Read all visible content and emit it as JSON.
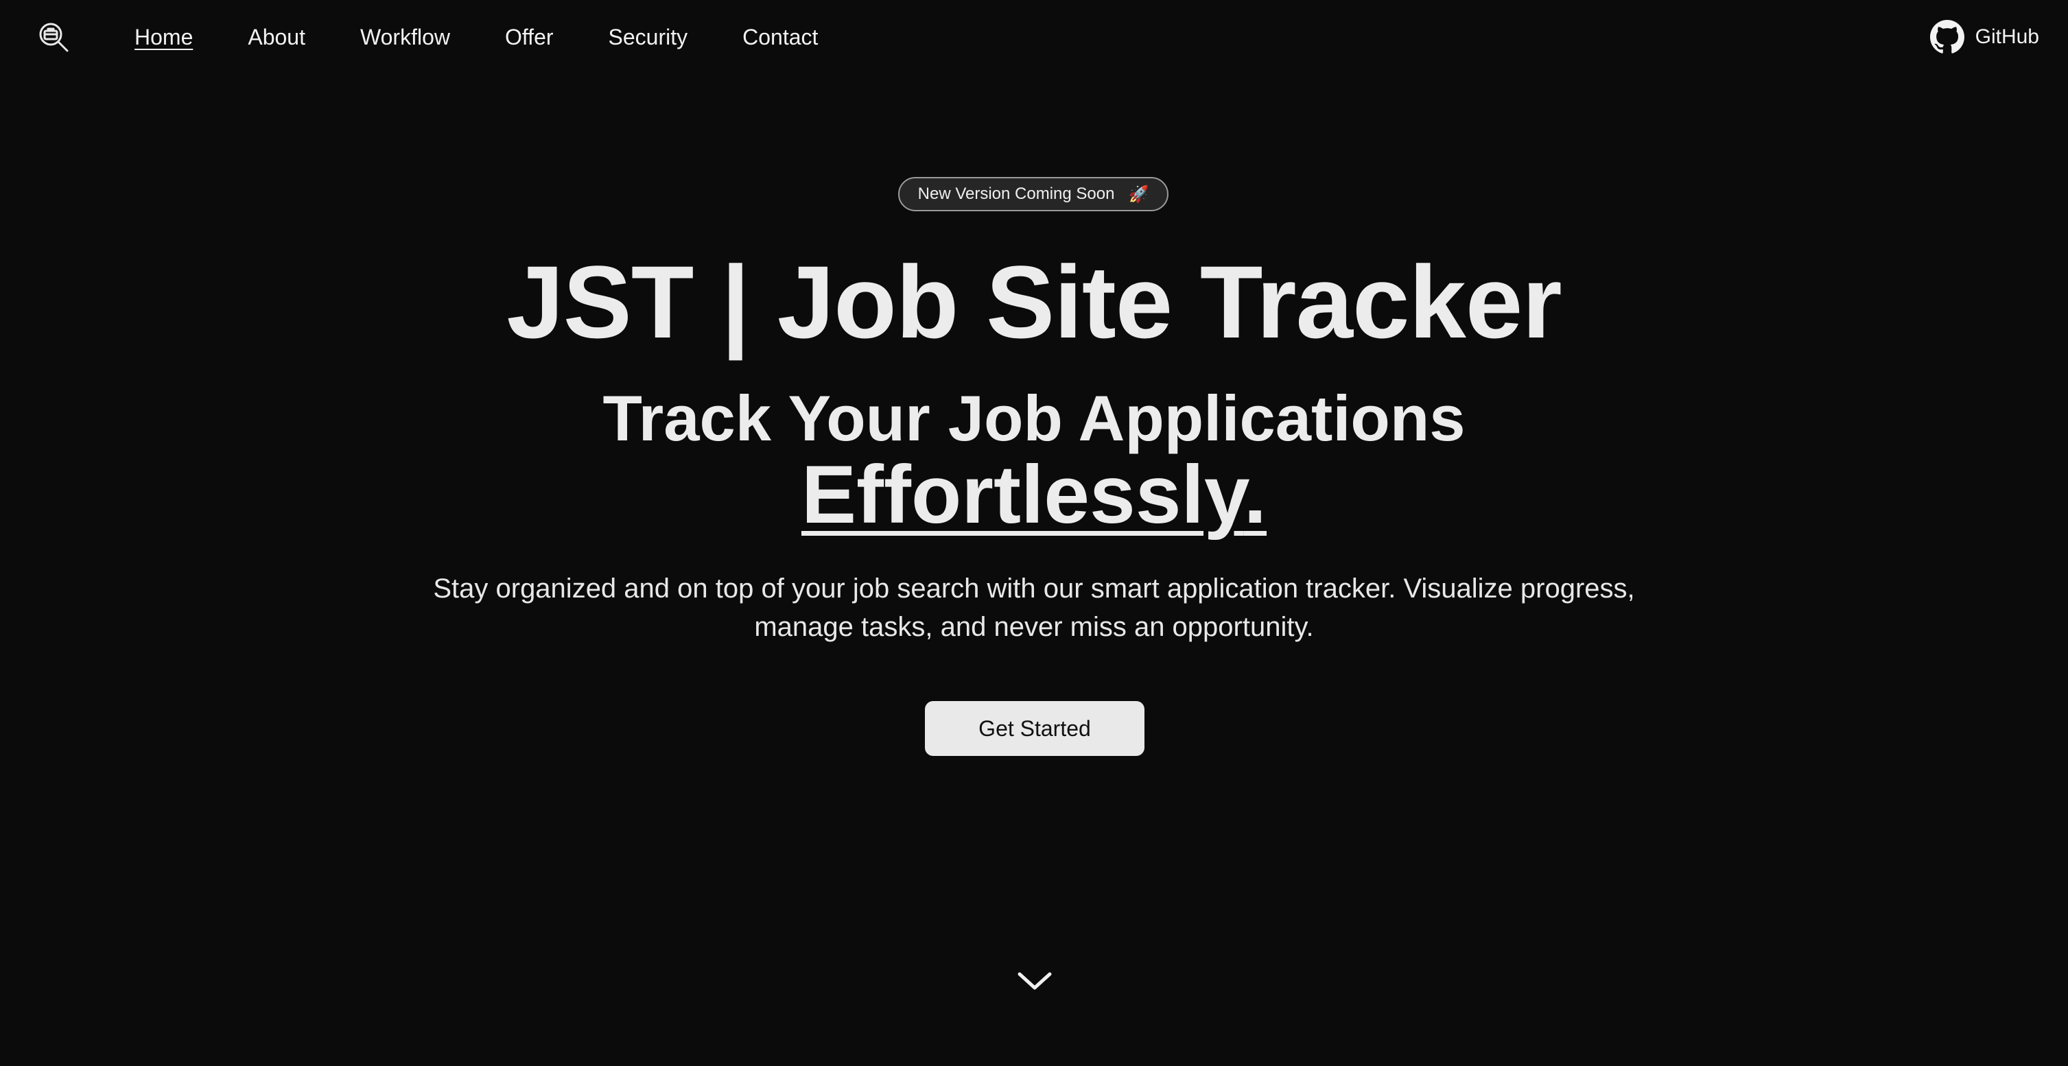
{
  "nav": {
    "logo_icon": "magnifier-briefcase-icon",
    "items": [
      {
        "label": "Home",
        "active": true
      },
      {
        "label": "About",
        "active": false
      },
      {
        "label": "Workflow",
        "active": false
      },
      {
        "label": "Offer",
        "active": false
      },
      {
        "label": "Security",
        "active": false
      },
      {
        "label": "Contact",
        "active": false
      }
    ],
    "github": {
      "label": "GitHub",
      "icon": "github-icon"
    }
  },
  "hero": {
    "badge": {
      "label": "New Version Coming Soon",
      "emoji": "🚀"
    },
    "title": "JST | Job Site Tracker",
    "subtitle": "Track Your Job Applications",
    "highlight": "Effortlessly",
    "highlight_suffix": ".",
    "description": "Stay organized and on top of your job search with our smart application tracker. Visualize progress, manage tasks, and never miss an opportunity.",
    "cta_label": "Get Started",
    "scroll_icon": "chevron-down-icon"
  },
  "colors": {
    "background": "#0b0b0b",
    "text": "#ececec",
    "button_bg": "#e9e9e9",
    "button_text": "#111111",
    "badge_bg": "#262626"
  }
}
